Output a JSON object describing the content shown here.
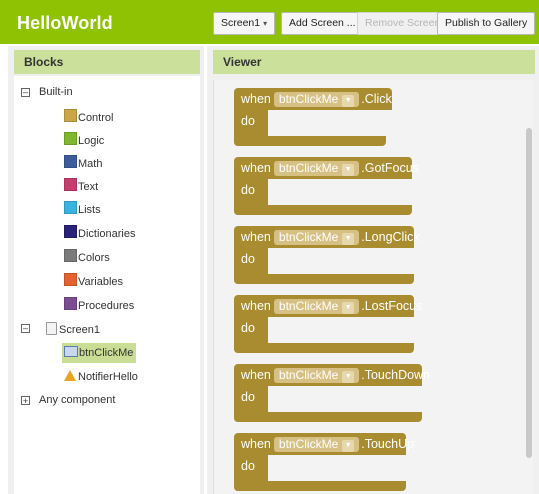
{
  "header": {
    "app_title": "HelloWorld",
    "screen_selector": "Screen1",
    "add_screen": "Add Screen ...",
    "remove_screen": "Remove Screen",
    "publish": "Publish to Gallery"
  },
  "blocks_panel": {
    "title": "Blocks",
    "builtin_label": "Built-in",
    "builtin_items": [
      {
        "label": "Control",
        "color": "#c9a747"
      },
      {
        "label": "Logic",
        "color": "#7fb830"
      },
      {
        "label": "Math",
        "color": "#3d5c9c"
      },
      {
        "label": "Text",
        "color": "#c43e6d"
      },
      {
        "label": "Lists",
        "color": "#3ab4df"
      },
      {
        "label": "Dictionaries",
        "color": "#28227a"
      },
      {
        "label": "Colors",
        "color": "#7b7b7b"
      },
      {
        "label": "Variables",
        "color": "#e2632e"
      },
      {
        "label": "Procedures",
        "color": "#7b4e93"
      }
    ],
    "screen_label": "Screen1",
    "components": [
      "btnClickMe",
      "NotifierHello"
    ],
    "any_component": "Any component"
  },
  "viewer": {
    "title": "Viewer",
    "events": [
      {
        "when": "when",
        "component": "btnClickMe",
        "event": ".Click",
        "do": "do"
      },
      {
        "when": "when",
        "component": "btnClickMe",
        "event": ".GotFocus",
        "do": "do"
      },
      {
        "when": "when",
        "component": "btnClickMe",
        "event": ".LongClick",
        "do": "do"
      },
      {
        "when": "when",
        "component": "btnClickMe",
        "event": ".LostFocus",
        "do": "do"
      },
      {
        "when": "when",
        "component": "btnClickMe",
        "event": ".TouchDown",
        "do": "do"
      },
      {
        "when": "when",
        "component": "btnClickMe",
        "event": ".TouchUp",
        "do": "do"
      }
    ]
  },
  "colors": {
    "topbar": "#8fc202",
    "panel_header": "#cbe09a",
    "event_block": "#a88c2f",
    "component_pill": "#d6c083"
  }
}
